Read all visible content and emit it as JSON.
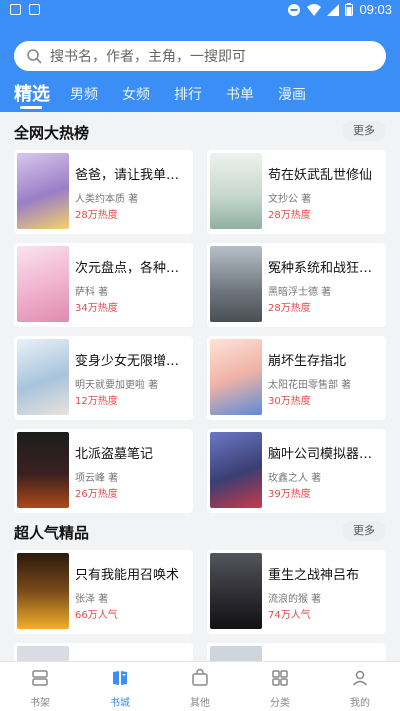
{
  "status_bar": {
    "time": "09:03"
  },
  "search": {
    "placeholder": "搜书名，作者，主角，一搜即可"
  },
  "tabs": [
    {
      "label": "精选",
      "active": true
    },
    {
      "label": "男频"
    },
    {
      "label": "女频"
    },
    {
      "label": "排行"
    },
    {
      "label": "书单"
    },
    {
      "label": "漫画"
    }
  ],
  "sections": [
    {
      "title": "全网大热榜",
      "more": "更多",
      "books": [
        {
          "title": "爸爸，请让我单推…",
          "author": "人类约本质 著",
          "heat": "28万热度",
          "cover_color": "#b9a6d8"
        },
        {
          "title": "苟在妖武乱世修仙",
          "author": "文抄公 著",
          "heat": "28万热度",
          "cover_color": "#c9d9d2"
        },
        {
          "title": "次元盘点，各种冥…",
          "author": "萨科 著",
          "heat": "34万热度",
          "cover_color": "#f2c8dc"
        },
        {
          "title": "冤种系统和战狂的…",
          "author": "黑暗浮士德 著",
          "heat": "28万热度",
          "cover_color": "#7c8590"
        },
        {
          "title": "变身少女无限增殖…",
          "author": "明天就要加更啦 著",
          "heat": "12万热度",
          "cover_color": "#a9c4dc"
        },
        {
          "title": "崩坏生存指北",
          "author": "太阳花田零售部 著",
          "heat": "30万热度",
          "cover_color": "#f0b2a6"
        },
        {
          "title": "北派盗墓笔记",
          "author": "项云峰 著",
          "heat": "26万热度",
          "cover_color": "#3a2020"
        },
        {
          "title": "脑叶公司模拟器，…",
          "author": "玫鑫之人 著",
          "heat": "39万热度",
          "cover_color": "#3b3e72"
        }
      ]
    },
    {
      "title": "超人气精品",
      "more": "更多",
      "books": [
        {
          "title": "只有我能用召唤术",
          "author": "张泽 著",
          "heat": "66万人气",
          "cover_color": "#7a4a1a"
        },
        {
          "title": "重生之战神吕布",
          "author": "流浪的猴 著",
          "heat": "74万人气",
          "cover_color": "#2d2d33"
        }
      ]
    }
  ],
  "bottom_nav": [
    {
      "label": "书架",
      "icon": "bookshelf-icon"
    },
    {
      "label": "书城",
      "icon": "bookstore-icon",
      "active": true
    },
    {
      "label": "其他",
      "icon": "bag-icon"
    },
    {
      "label": "分类",
      "icon": "category-icon"
    },
    {
      "label": "我的",
      "icon": "user-icon"
    }
  ],
  "colors": {
    "brand": "#3a8ef6",
    "heat": "#e34b4b"
  }
}
